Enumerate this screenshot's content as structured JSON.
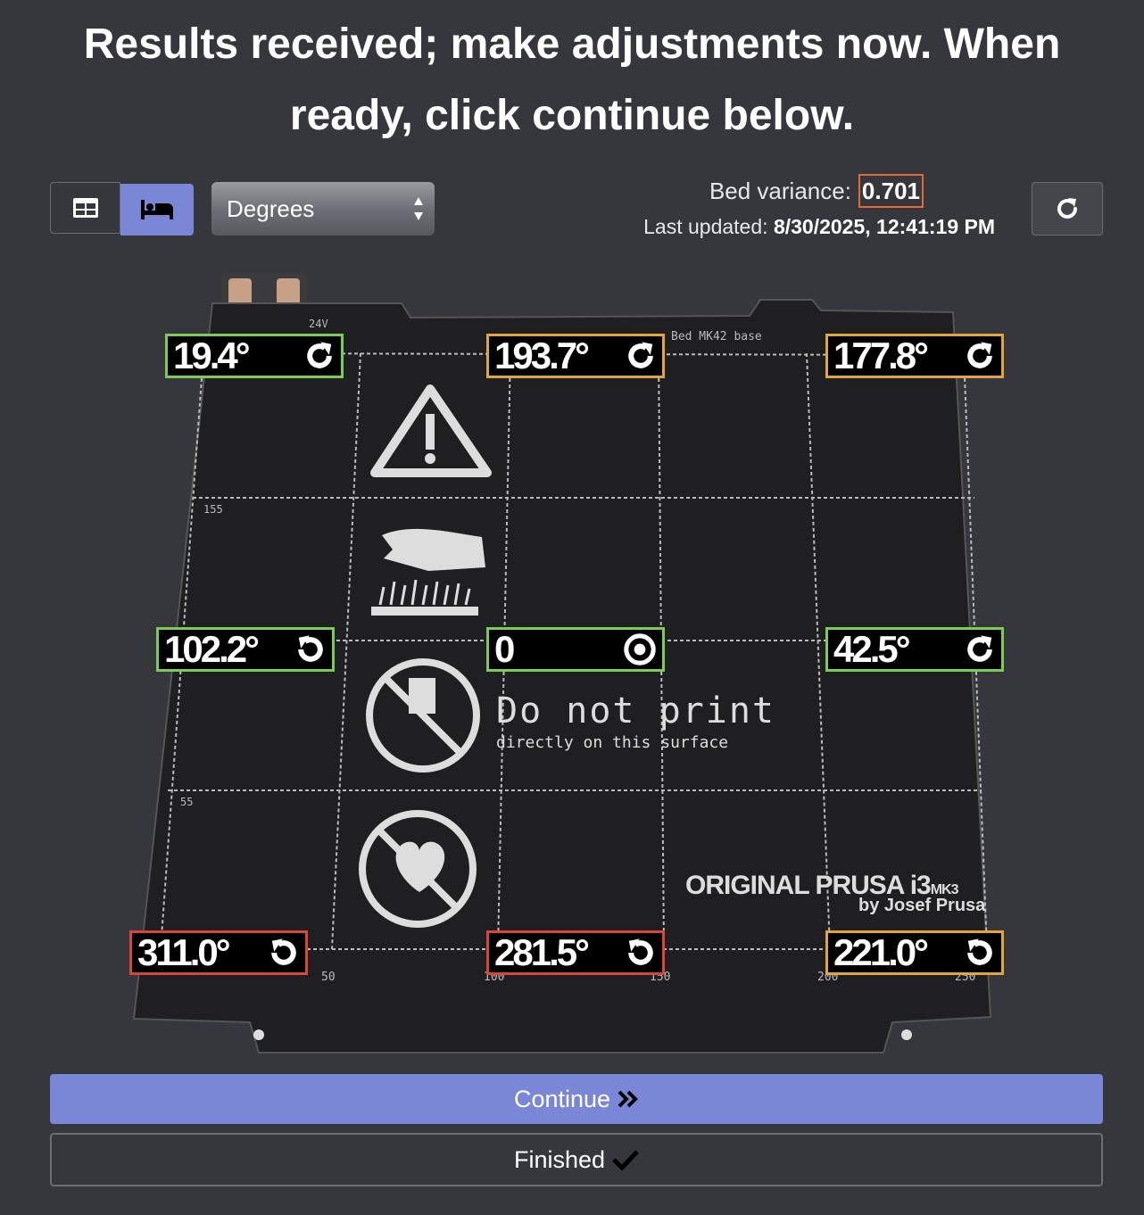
{
  "heading": {
    "line1": "Results received; make adjustments now. When",
    "line2": "ready, click continue below."
  },
  "toolbar": {
    "view_toggle": {
      "table_icon": "table-icon",
      "bed_icon": "bed-icon",
      "active": "bed"
    },
    "units_select": {
      "value": "Degrees"
    },
    "variance_label": "Bed variance:",
    "variance_value": "0.701",
    "updated_label": "Last updated:",
    "updated_value": "8/30/2025, 12:41:19 PM",
    "refresh_icon": "refresh-icon"
  },
  "bed": {
    "print_text_1": "Do not print",
    "print_text_2": "directly on this surface",
    "brand_1": "ORIGINAL PRUSA i3",
    "brand_sup": "MK3",
    "brand_2": "by Josef Prusa",
    "board_text": "Bed MK42 base",
    "voltage": "24V",
    "ruler": [
      "155",
      "55",
      "50",
      "100",
      "150",
      "200",
      "250"
    ]
  },
  "points": [
    {
      "label": "19.4°",
      "icon": "rotate-clockwise-icon",
      "status": "green"
    },
    {
      "label": "193.7°",
      "icon": "rotate-clockwise-icon",
      "status": "orange"
    },
    {
      "label": "177.8°",
      "icon": "rotate-clockwise-icon",
      "status": "orange"
    },
    {
      "label": "102.2°",
      "icon": "rotate-counterclockwise-icon",
      "status": "green"
    },
    {
      "label": "0",
      "icon": "target-icon",
      "status": "green"
    },
    {
      "label": "42.5°",
      "icon": "rotate-clockwise-icon",
      "status": "green"
    },
    {
      "label": "311.0°",
      "icon": "rotate-counterclockwise-icon",
      "status": "red"
    },
    {
      "label": "281.5°",
      "icon": "rotate-counterclockwise-icon",
      "status": "red"
    },
    {
      "label": "221.0°",
      "icon": "rotate-counterclockwise-icon",
      "status": "orange"
    }
  ],
  "buttons": {
    "continue": "Continue",
    "finished": "Finished"
  },
  "colors": {
    "background": "#36373d",
    "accent": "#7a86d6",
    "good": "#7ccb52",
    "warn": "#e2a53a",
    "bad": "#d8453a",
    "variance_border": "#e06a3a"
  }
}
